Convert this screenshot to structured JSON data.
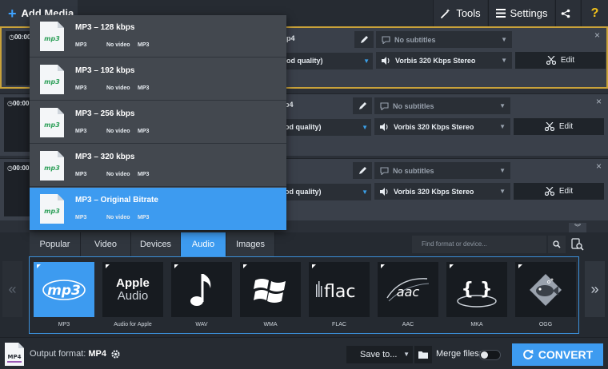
{
  "toolbar": {
    "add_media_label": "Add Media",
    "tools_label": "Tools",
    "settings_label": "Settings",
    "help_label": "?"
  },
  "files": [
    {
      "time": "00:00",
      "format_fragment": "p4",
      "quality_fragment": "od quality)",
      "subtitles": "No subtitles",
      "audio": "Vorbis 320 Kbps Stereo",
      "edit_label": "Edit",
      "close": "×"
    },
    {
      "time": "00:00",
      "format_fragment": "p4",
      "quality_fragment": "od quality)",
      "subtitles": "No subtitles",
      "audio": "Vorbis 320 Kbps Stereo",
      "edit_label": "Edit",
      "close": "×"
    },
    {
      "time": "00:00",
      "format_fragment": "p4",
      "quality_fragment": "od quality)",
      "subtitles": "No subtitles",
      "audio": "Vorbis 320 Kbps Stereo",
      "edit_label": "Edit",
      "close": "×"
    }
  ],
  "dropdown": {
    "items": [
      {
        "title": "MP3 – 128 kbps",
        "codec": "MP3",
        "video": "No video",
        "audio": "MP3",
        "icon_text": "mp3"
      },
      {
        "title": "MP3 – 192 kbps",
        "codec": "MP3",
        "video": "No video",
        "audio": "MP3",
        "icon_text": "mp3"
      },
      {
        "title": "MP3 – 256 kbps",
        "codec": "MP3",
        "video": "No video",
        "audio": "MP3",
        "icon_text": "mp3"
      },
      {
        "title": "MP3 – 320 kbps",
        "codec": "MP3",
        "video": "No video",
        "audio": "MP3",
        "icon_text": "mp3"
      },
      {
        "title": "MP3 – Original Bitrate",
        "codec": "MP3",
        "video": "No video",
        "audio": "MP3",
        "icon_text": "mp3"
      }
    ],
    "selected_index": 4
  },
  "format_panel": {
    "tabs": [
      "Popular",
      "Video",
      "Devices",
      "Audio",
      "Images"
    ],
    "active_tab": "Audio",
    "search_placeholder": "Find format or device...",
    "arrow_left": "«",
    "arrow_right": "»",
    "formats": [
      {
        "label": "MP3",
        "logo": "mp3"
      },
      {
        "label": "Audio for Apple",
        "logo_line1": "Apple",
        "logo_line2": "Audio"
      },
      {
        "label": "WAV",
        "logo": "note-icon"
      },
      {
        "label": "WMA",
        "logo": "windows-icon"
      },
      {
        "label": "FLAC",
        "logo": "flac"
      },
      {
        "label": "AAC",
        "logo": "aac"
      },
      {
        "label": "MKA",
        "logo": "{ }"
      },
      {
        "label": "OGG",
        "logo": "ogg-fish-icon"
      }
    ],
    "active_format": "MP3"
  },
  "bottom": {
    "output_prefix": "Output format:",
    "output_format": "MP4",
    "output_icon_text": "MP4",
    "save_to_label": "Save to...",
    "merge_label": "Merge files:",
    "merge_on": false,
    "convert_label": "CONVERT"
  },
  "colors": {
    "accent": "#3d9bf0",
    "highlight_border": "#c9a23a",
    "help": "#f2c21a"
  }
}
